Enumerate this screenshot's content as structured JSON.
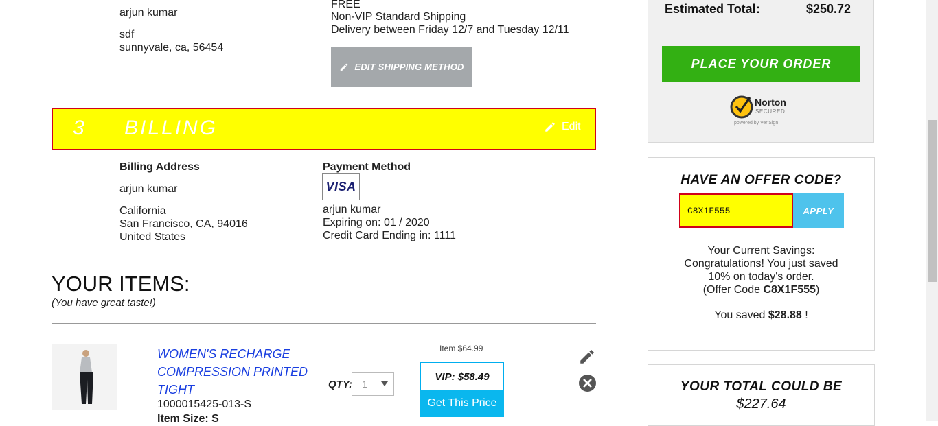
{
  "shipping": {
    "address_name": "arjun kumar",
    "address_line1": "sdf",
    "address_line2": "sunnyvale, ca, 56454",
    "cost": "FREE",
    "method": "Non-VIP Standard Shipping",
    "delivery": "Delivery between Friday 12/7 and Tuesday 12/11",
    "edit_button": "EDIT SHIPPING METHOD"
  },
  "billing": {
    "step_number": "3",
    "title": "BILLING",
    "edit_label": "Edit",
    "address_heading": "Billing Address",
    "address_name": "arjun kumar",
    "address_line1": "California",
    "address_line2": "San Francisco, CA, 94016",
    "address_line3": "United States",
    "payment_heading": "Payment Method",
    "card_brand": "VISA",
    "card_holder": "arjun kumar",
    "expiry": "Expiring on: 01 / 2020",
    "card_ending": "Credit Card Ending in: 1111"
  },
  "items": {
    "title": "YOUR ITEMS:",
    "subtitle": "(You have great taste!)",
    "list": [
      {
        "name": "WOMEN'S RECHARGE COMPRESSION PRINTED TIGHT",
        "sku": "1000015425-013-S",
        "size_label": "Item Size: S",
        "qty_label": "QTY:",
        "qty": "1",
        "item_price": "Item $64.99",
        "vip_price": "VIP: $58.49",
        "cta": "Get This Price"
      }
    ]
  },
  "summary": {
    "estimated_total_label": "Estimated Total:",
    "estimated_total_value": "$250.72",
    "place_order": "PLACE YOUR ORDER",
    "norton_brand": "Norton",
    "norton_secured": "SECURED",
    "norton_powered": "powered by VeriSign"
  },
  "offer": {
    "title": "HAVE AN OFFER CODE?",
    "code_value": "C8X1F555",
    "apply": "APPLY",
    "savings_line1": "Your Current Savings:",
    "savings_line2": "Congratulations! You just saved",
    "savings_line3": "10% on today's order.",
    "savings_line4_prefix": "(Offer Code ",
    "savings_line4_code": "C8X1F555",
    "savings_line4_suffix": ")",
    "saved_prefix": "You saved ",
    "saved_amount": "$28.88",
    "saved_suffix": " !"
  },
  "total_could_be": {
    "label": "YOUR TOTAL COULD BE",
    "value": "$227.64"
  },
  "colors": {
    "billing_bar": "#ffff00",
    "billing_border": "#d0021b",
    "place_order": "#33b013",
    "apply": "#4ec3ec",
    "get_price": "#0ab7ee",
    "product_link": "#1a3fe0"
  }
}
